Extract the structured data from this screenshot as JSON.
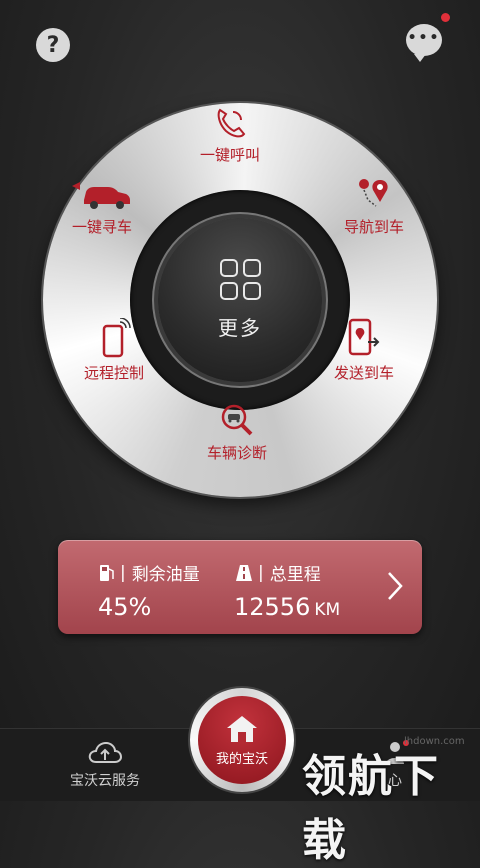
{
  "header": {
    "help_glyph": "?",
    "chat_glyph": "•••"
  },
  "dial": {
    "center_label": "更多",
    "items": [
      {
        "label": "一键呼叫",
        "icon": "phone-icon"
      },
      {
        "label": "导航到车",
        "icon": "navigation-icon"
      },
      {
        "label": "发送到车",
        "icon": "send-to-car-icon"
      },
      {
        "label": "车辆诊断",
        "icon": "diagnosis-icon"
      },
      {
        "label": "远程控制",
        "icon": "remote-control-icon"
      },
      {
        "label": "一键寻车",
        "icon": "find-car-icon"
      }
    ]
  },
  "info_card": {
    "fuel_label": "剩余油量",
    "fuel_value": "45%",
    "mileage_label": "总里程",
    "mileage_value": "12556",
    "mileage_unit": "KM",
    "separator": "|"
  },
  "bottom_nav": {
    "left_label": "宝沃云服务",
    "home_label": "我的宝沃",
    "right_label": "心"
  },
  "watermark": {
    "text": "领航下载",
    "url": "lhdown.com"
  },
  "colors": {
    "accent": "#b3202a",
    "card": "#b0555c"
  }
}
